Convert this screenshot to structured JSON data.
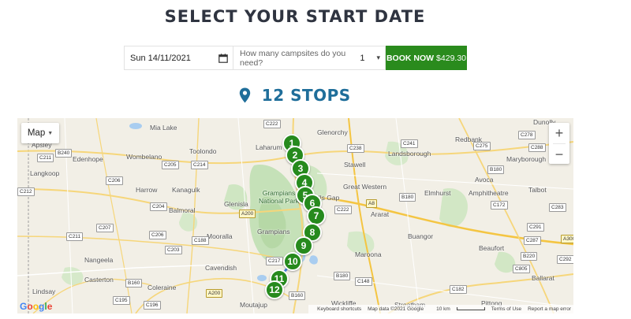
{
  "page": {
    "title": "SELECT YOUR START DATE"
  },
  "booking": {
    "date_value": "Sun 14/11/2021",
    "campsite_question": "How many campsites do you need?",
    "campsite_count": "1",
    "book_label": "BOOK NOW",
    "book_price": "$429.30"
  },
  "stops": {
    "heading": "12 STOPS"
  },
  "map": {
    "type_label": "Map",
    "zoom_in": "+",
    "zoom_out": "−",
    "places": {
      "apsley": "Apsley",
      "mia_lake": "Mia Lake",
      "glenorchy": "Glenorchy",
      "dunolly": "Dunolly",
      "laharum": "Laharum",
      "toolondo": "Toolondo",
      "redbank": "Redbank",
      "edenhope": "Edenhope",
      "wombelano": "Wombelano",
      "landsborough": "Landsborough",
      "maryborough": "Maryborough",
      "stawell": "Stawell",
      "langkoop": "Langkoop",
      "avoca": "Avoca",
      "great_western": "Great Western",
      "harrow": "Harrow",
      "kanagulk": "Kanagulk",
      "elmhurst": "Elmhurst",
      "amphitheatre": "Amphitheatre",
      "talbot": "Talbot",
      "grampians_np": "Grampians\nNational Park",
      "halls_gap": "Halls Gap",
      "glenisla": "Glenisla",
      "balmoral": "Balmoral",
      "ararat": "Ararat",
      "grampians": "Grampians",
      "mooralla": "Mooralla",
      "buangor": "Buangor",
      "beaufort": "Beaufort",
      "nangeela": "Nangeela",
      "maroona": "Maroona",
      "casterton": "Casterton",
      "cavendish": "Cavendish",
      "ballarat": "Ballarat",
      "coleraine": "Coleraine",
      "lindsay": "Lindsay",
      "moutajup": "Moutajup",
      "wickliffe": "Wickliffe",
      "streatham": "Streatham",
      "pitting": "Pittong"
    },
    "roads": {
      "c222": "C222",
      "b240": "B240",
      "c211": "C211",
      "c205": "C205",
      "c214": "C214",
      "c238": "C238",
      "c241": "C241",
      "c275": "C275",
      "c278": "C278",
      "c288": "C288",
      "c212": "C212",
      "c206": "C206",
      "a8a": "A8",
      "b180a": "B180",
      "b180b": "B180",
      "c204": "C204",
      "a200a": "A200",
      "c222b": "C222",
      "c172": "C172",
      "c283": "C283",
      "c207": "C207",
      "c206b": "C206",
      "c188": "C188",
      "c211b": "C211",
      "c291": "C291",
      "c287": "C287",
      "a300": "A300",
      "c203": "C203",
      "c217": "C217",
      "b220": "B220",
      "c292": "C292",
      "c805": "C805",
      "b180c": "B180",
      "c148": "C148",
      "b160a": "B160",
      "c195": "C195",
      "c196": "C196",
      "a200b": "A200",
      "b160b": "B160",
      "c182": "C182"
    },
    "markers": [
      "1",
      "2",
      "3",
      "4",
      "5",
      "6",
      "7",
      "8",
      "9",
      "10",
      "11",
      "12"
    ],
    "google_letters": [
      "G",
      "o",
      "o",
      "g",
      "l",
      "e"
    ],
    "google_colors": [
      "#4285F4",
      "#EA4335",
      "#FBBC05",
      "#4285F4",
      "#34A853",
      "#EA4335"
    ],
    "footer": {
      "shortcuts": "Keyboard shortcuts",
      "data": "Map data ©2021 Google",
      "scale": "10 km",
      "terms": "Terms of Use",
      "report": "Report a map error"
    }
  },
  "colors": {
    "accent_green": "#2a8b1d",
    "marker_green": "#268a1d",
    "heading_blue": "#1f6e9a",
    "title_dark": "#2f3440"
  }
}
